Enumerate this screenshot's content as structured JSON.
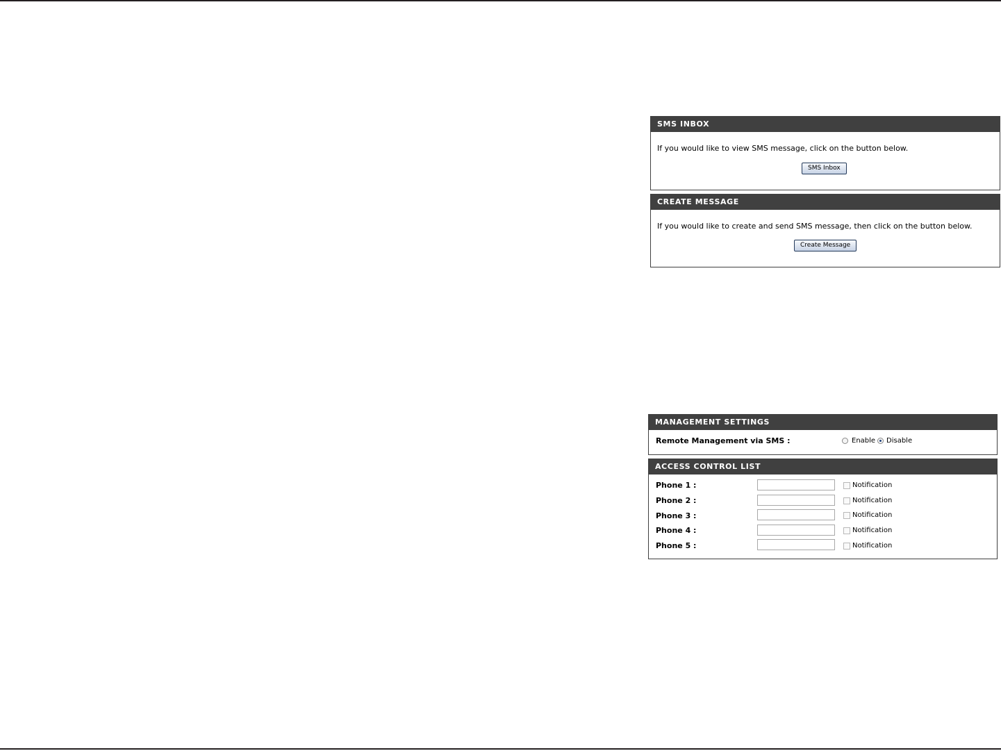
{
  "sms_inbox": {
    "title": "SMS INBOX",
    "description": "If you would like to view SMS message, click on the button below.",
    "button_label": "SMS Inbox"
  },
  "create_message": {
    "title": "CREATE MESSAGE",
    "description": "If you would like to create and send SMS message, then click on the button below.",
    "button_label": "Create Message"
  },
  "management_settings": {
    "title": "MANAGEMENT SETTINGS",
    "remote_label": "Remote Management via SMS :",
    "enable_label": "Enable",
    "disable_label": "Disable",
    "selected": "Disable"
  },
  "access_control": {
    "title": "ACCESS CONTROL LIST",
    "rows": [
      {
        "label": "Phone 1 :",
        "value": "",
        "notification_label": "Notification",
        "notification_checked": false
      },
      {
        "label": "Phone 2 :",
        "value": "",
        "notification_label": "Notification",
        "notification_checked": false
      },
      {
        "label": "Phone 3 :",
        "value": "",
        "notification_label": "Notification",
        "notification_checked": false
      },
      {
        "label": "Phone 4 :",
        "value": "",
        "notification_label": "Notification",
        "notification_checked": false
      },
      {
        "label": "Phone 5 :",
        "value": "",
        "notification_label": "Notification",
        "notification_checked": false
      }
    ]
  }
}
